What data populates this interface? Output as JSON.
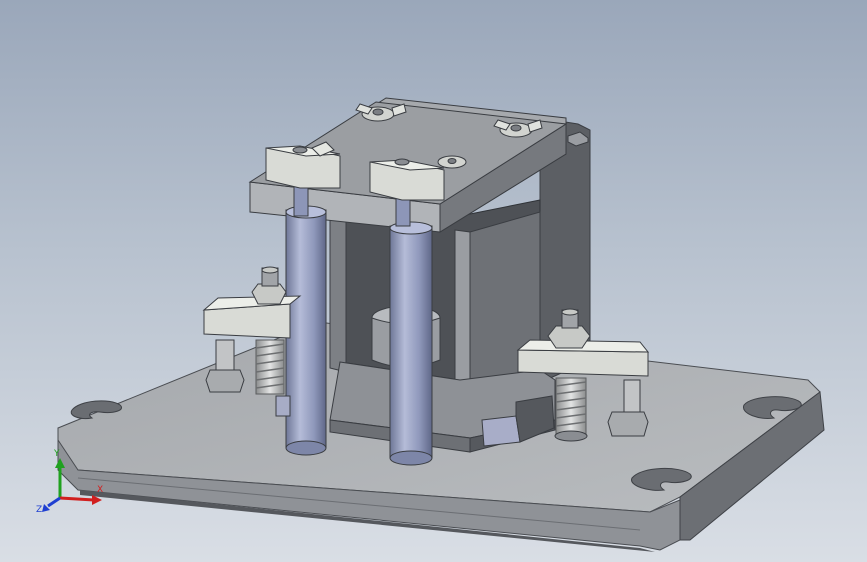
{
  "viewport": {
    "background_top": "#9aa7ba",
    "background_bottom": "#d9dee5"
  },
  "model": {
    "colors": {
      "base_top": "#aeb1b5",
      "base_front": "#8d9095",
      "base_side": "#6f7277",
      "frame_dark": "#5e6166",
      "frame_mid": "#8e9196",
      "frame_light": "#b4b7bb",
      "clamp_light": "#d9dbd6",
      "pillar": "#9aa3c4",
      "spring": "#c9cbcc"
    }
  },
  "triad": {
    "x_label": "X",
    "y_label": "Y",
    "z_label": "Z",
    "x_color": "#d11f1f",
    "y_color": "#1fa11f",
    "z_color": "#1f3fd1"
  }
}
